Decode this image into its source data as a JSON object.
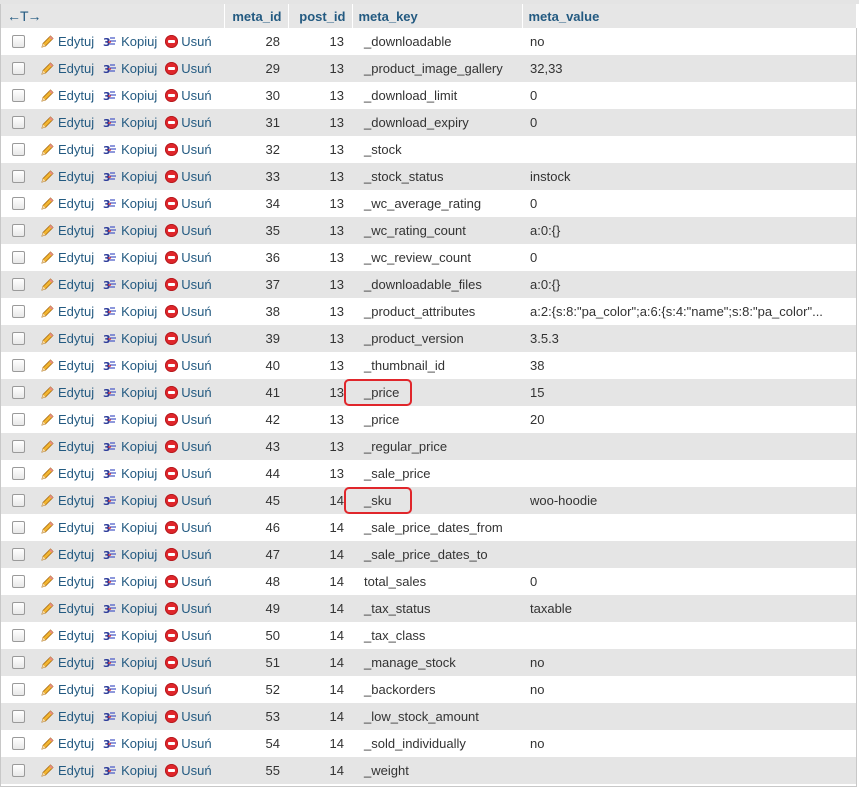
{
  "header": {
    "arrows": "←T→",
    "meta_id": "meta_id",
    "post_id": "post_id",
    "meta_key": "meta_key",
    "meta_value": "meta_value"
  },
  "actions": {
    "edit": "Edytuj",
    "copy": "Kopiuj",
    "delete": "Usuń"
  },
  "colors": {
    "link": "#235a81",
    "highlight": "#e0262b",
    "row_even": "#e5e5e5"
  },
  "rows": [
    {
      "meta_id": "28",
      "post_id": "13",
      "meta_key": "_downloadable",
      "meta_value": "no"
    },
    {
      "meta_id": "29",
      "post_id": "13",
      "meta_key": "_product_image_gallery",
      "meta_value": "32,33"
    },
    {
      "meta_id": "30",
      "post_id": "13",
      "meta_key": "_download_limit",
      "meta_value": "0"
    },
    {
      "meta_id": "31",
      "post_id": "13",
      "meta_key": "_download_expiry",
      "meta_value": "0"
    },
    {
      "meta_id": "32",
      "post_id": "13",
      "meta_key": "_stock",
      "meta_value": ""
    },
    {
      "meta_id": "33",
      "post_id": "13",
      "meta_key": "_stock_status",
      "meta_value": "instock"
    },
    {
      "meta_id": "34",
      "post_id": "13",
      "meta_key": "_wc_average_rating",
      "meta_value": "0"
    },
    {
      "meta_id": "35",
      "post_id": "13",
      "meta_key": "_wc_rating_count",
      "meta_value": "a:0:{}"
    },
    {
      "meta_id": "36",
      "post_id": "13",
      "meta_key": "_wc_review_count",
      "meta_value": "0"
    },
    {
      "meta_id": "37",
      "post_id": "13",
      "meta_key": "_downloadable_files",
      "meta_value": "a:0:{}"
    },
    {
      "meta_id": "38",
      "post_id": "13",
      "meta_key": "_product_attributes",
      "meta_value": "a:2:{s:8:\"pa_color\";a:6:{s:4:\"name\";s:8:\"pa_color\"..."
    },
    {
      "meta_id": "39",
      "post_id": "13",
      "meta_key": "_product_version",
      "meta_value": "3.5.3"
    },
    {
      "meta_id": "40",
      "post_id": "13",
      "meta_key": "_thumbnail_id",
      "meta_value": "38"
    },
    {
      "meta_id": "41",
      "post_id": "13",
      "meta_key": "_price",
      "meta_value": "15",
      "highlight": true
    },
    {
      "meta_id": "42",
      "post_id": "13",
      "meta_key": "_price",
      "meta_value": "20"
    },
    {
      "meta_id": "43",
      "post_id": "13",
      "meta_key": "_regular_price",
      "meta_value": ""
    },
    {
      "meta_id": "44",
      "post_id": "13",
      "meta_key": "_sale_price",
      "meta_value": ""
    },
    {
      "meta_id": "45",
      "post_id": "14",
      "meta_key": "_sku",
      "meta_value": "woo-hoodie",
      "highlight": true
    },
    {
      "meta_id": "46",
      "post_id": "14",
      "meta_key": "_sale_price_dates_from",
      "meta_value": ""
    },
    {
      "meta_id": "47",
      "post_id": "14",
      "meta_key": "_sale_price_dates_to",
      "meta_value": ""
    },
    {
      "meta_id": "48",
      "post_id": "14",
      "meta_key": "total_sales",
      "meta_value": "0"
    },
    {
      "meta_id": "49",
      "post_id": "14",
      "meta_key": "_tax_status",
      "meta_value": "taxable"
    },
    {
      "meta_id": "50",
      "post_id": "14",
      "meta_key": "_tax_class",
      "meta_value": ""
    },
    {
      "meta_id": "51",
      "post_id": "14",
      "meta_key": "_manage_stock",
      "meta_value": "no"
    },
    {
      "meta_id": "52",
      "post_id": "14",
      "meta_key": "_backorders",
      "meta_value": "no"
    },
    {
      "meta_id": "53",
      "post_id": "14",
      "meta_key": "_low_stock_amount",
      "meta_value": ""
    },
    {
      "meta_id": "54",
      "post_id": "14",
      "meta_key": "_sold_individually",
      "meta_value": "no"
    },
    {
      "meta_id": "55",
      "post_id": "14",
      "meta_key": "_weight",
      "meta_value": ""
    }
  ]
}
